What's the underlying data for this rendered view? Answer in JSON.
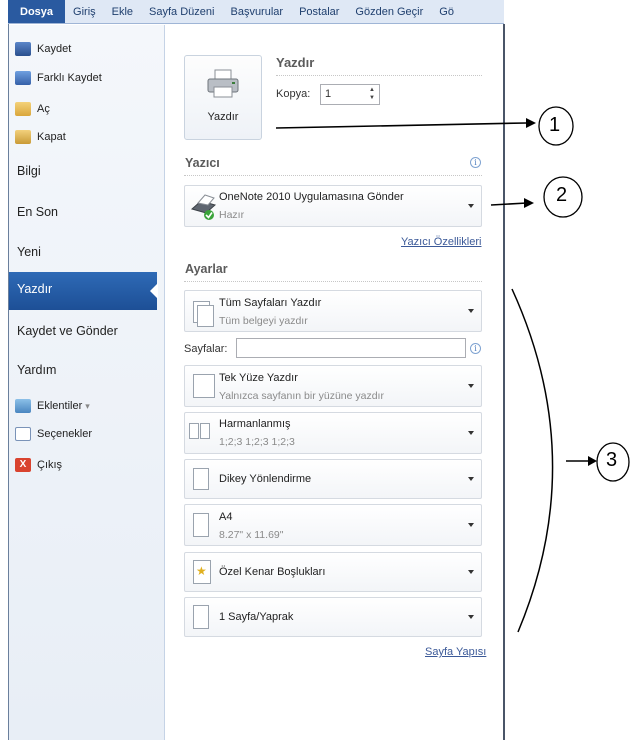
{
  "ribbon": {
    "tabs": [
      "Dosya",
      "Giriş",
      "Ekle",
      "Sayfa Düzeni",
      "Başvurular",
      "Postalar",
      "Gözden Geçir",
      "Gö"
    ]
  },
  "sidebar": {
    "commands": [
      "Kaydet",
      "Farklı Kaydet",
      "Aç",
      "Kapat"
    ],
    "sections": [
      "Bilgi",
      "En Son",
      "Yeni",
      "Yazdır",
      "Kaydet ve Gönder",
      "Yardım"
    ],
    "bottom": [
      "Eklentiler",
      "Seçenekler",
      "Çıkış"
    ],
    "addins_arrow": "▾",
    "exit_glyph": "X",
    "selected": "Yazdır"
  },
  "print": {
    "button_label": "Yazdır",
    "title": "Yazdır",
    "copies_label": "Kopya:",
    "copies_value": "1"
  },
  "printer": {
    "heading": "Yazıcı",
    "name": "OneNote 2010 Uygulamasına Gönder",
    "status": "Hazır",
    "properties_link": "Yazıcı Özellikleri"
  },
  "settings": {
    "heading": "Ayarlar",
    "print_all": {
      "main": "Tüm Sayfaları Yazdır",
      "sub": "Tüm belgeyi yazdır"
    },
    "pages_label": "Sayfalar:",
    "pages_value": "",
    "sides": {
      "main": "Tek Yüze Yazdır",
      "sub": "Yalnızca sayfanın bir yüzüne yazdır"
    },
    "collate": {
      "main": "Harmanlanmış",
      "sub": "1;2;3   1;2;3   1;2;3"
    },
    "orientation": "Dikey Yönlendirme",
    "paper": {
      "main": "A4",
      "sub": "8.27\" x 11.69\""
    },
    "margins": "Özel Kenar Boşlukları",
    "per_sheet": "1 Sayfa/Yaprak",
    "page_setup_link": "Sayfa Yapısı"
  },
  "info_glyph": "i",
  "annotations": [
    "1",
    "2",
    "3"
  ],
  "colors": {
    "accent": "#2a5aa0",
    "selected_bg": "#2462ad",
    "link": "#3b5998"
  }
}
